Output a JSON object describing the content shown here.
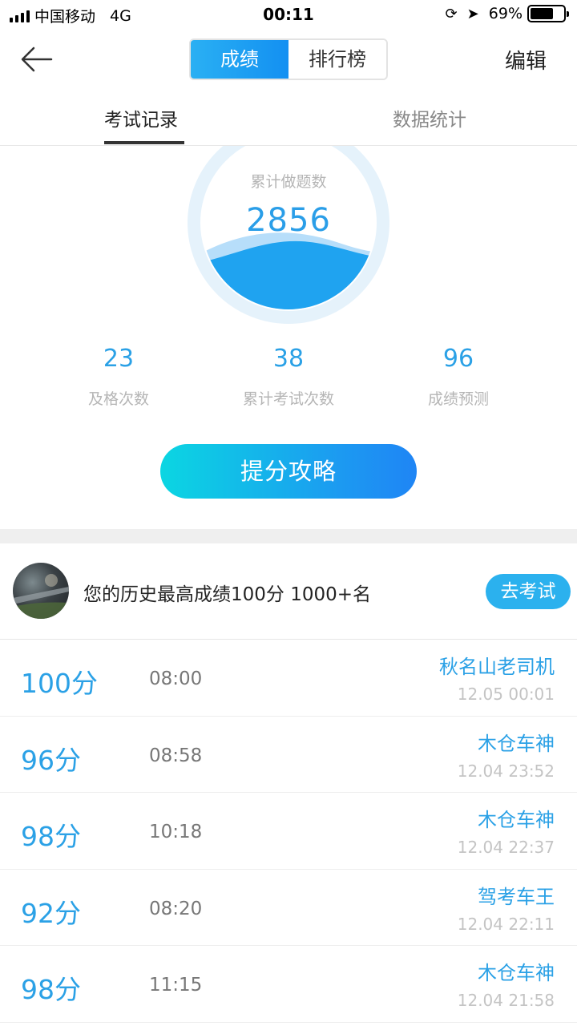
{
  "status_bar": {
    "carrier": "中国移动",
    "network": "4G",
    "time": "00:11",
    "battery_percent": "69%",
    "battery_level": 0.69
  },
  "nav": {
    "tabs": [
      "成绩",
      "排行榜"
    ],
    "active_tab": 0,
    "edit_label": "编辑"
  },
  "sub_tabs": [
    "考试记录",
    "数据统计"
  ],
  "gauge": {
    "label": "累计做题数",
    "value": "2856"
  },
  "stats": [
    {
      "value": "23",
      "label": "及格次数"
    },
    {
      "value": "38",
      "label": "累计考试次数"
    },
    {
      "value": "96",
      "label": "成绩预测"
    }
  ],
  "boost_button": "提分攻略",
  "best": {
    "text": "您的历史最高成绩100分 1000+名",
    "go_button": "去考试"
  },
  "records": [
    {
      "score": "100分",
      "duration": "08:00",
      "nickname": "秋名山老司机",
      "date": "12.05 00:01"
    },
    {
      "score": "96分",
      "duration": "08:58",
      "nickname": "木仓车神",
      "date": "12.04 23:52"
    },
    {
      "score": "98分",
      "duration": "10:18",
      "nickname": "木仓车神",
      "date": "12.04 22:37"
    },
    {
      "score": "92分",
      "duration": "08:20",
      "nickname": "驾考车王",
      "date": "12.04 22:11"
    },
    {
      "score": "98分",
      "duration": "11:15",
      "nickname": "木仓车神",
      "date": "12.04 21:58"
    }
  ],
  "colors": {
    "accent": "#2ba1e6",
    "wave": "#1fa3f0",
    "ring": "#e3f1fb"
  }
}
